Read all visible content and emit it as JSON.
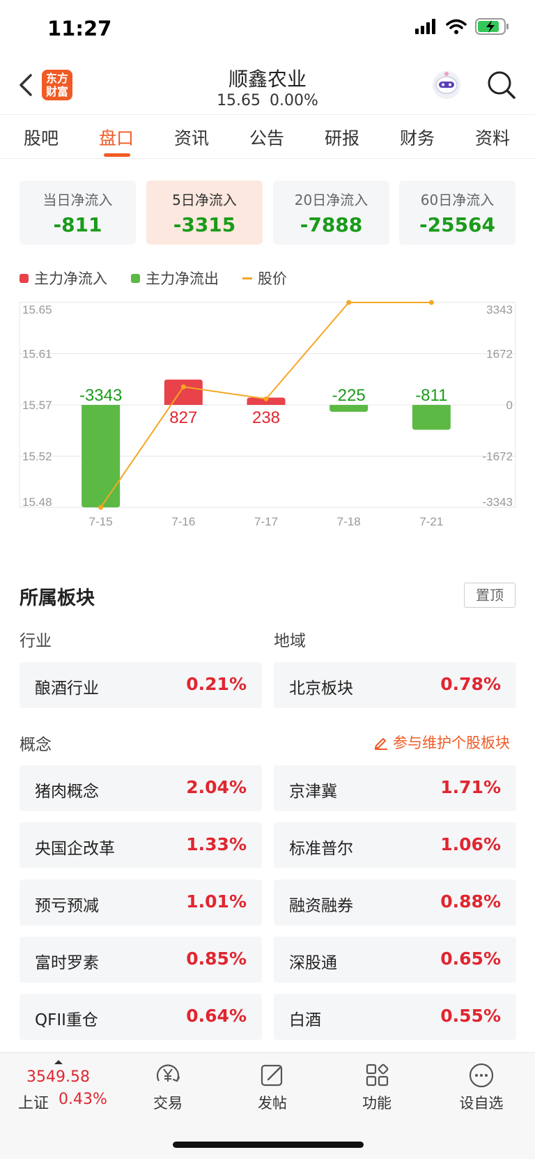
{
  "status": {
    "time": "11:27"
  },
  "header": {
    "stock_name": "顺鑫农业",
    "price": "15.65",
    "change": "0.00%"
  },
  "logo_text": [
    "东方",
    "财富"
  ],
  "tabs": [
    {
      "label": "股吧"
    },
    {
      "label": "盘口"
    },
    {
      "label": "资讯"
    },
    {
      "label": "公告"
    },
    {
      "label": "研报"
    },
    {
      "label": "财务"
    },
    {
      "label": "资料"
    }
  ],
  "active_tab": "盘口",
  "flow_cards": [
    {
      "label": "当日净流入",
      "value": "-811"
    },
    {
      "label": "5日净流入",
      "value": "-3315"
    },
    {
      "label": "20日净流入",
      "value": "-7888"
    },
    {
      "label": "60日净流入",
      "value": "-25564"
    }
  ],
  "legend": {
    "inflow": "主力净流入",
    "outflow": "主力净流出",
    "price": "股价"
  },
  "colors": {
    "accent": "#f05a24",
    "up": "#e0262f",
    "down_bar": "#5cb944",
    "down_text": "#1a9b1a",
    "price_line": "#f5a623",
    "inflow_bar": "#e8424a"
  },
  "chart_data": {
    "type": "bar",
    "categories": [
      "7-15",
      "7-16",
      "7-17",
      "7-18",
      "7-21"
    ],
    "series": [
      {
        "name": "主力净流入/净流出",
        "values": [
          -3343,
          827,
          238,
          -225,
          -811
        ]
      },
      {
        "name": "股价",
        "values": [
          15.48,
          15.58,
          15.57,
          15.65,
          15.65
        ]
      }
    ],
    "value_labels": [
      "-3343",
      "827",
      "238",
      "-225",
      "-811"
    ],
    "left_ticks": [
      "15.65",
      "15.61",
      "15.57",
      "15.52",
      "15.48"
    ],
    "right_ticks": [
      "3343",
      "1672",
      "0",
      "-1672",
      "-3343"
    ],
    "left_range": [
      15.48,
      15.65
    ],
    "right_range": [
      -3343,
      3343
    ],
    "grid": true
  },
  "section": {
    "title": "所属板块",
    "pin_label": "置顶",
    "industry_label": "行业",
    "region_label": "地域",
    "concept_label": "概念",
    "maintain_link": "参与维护个股板块",
    "industry": {
      "name": "酿酒行业",
      "pct": "0.21%"
    },
    "region": {
      "name": "北京板块",
      "pct": "0.78%"
    },
    "concepts": [
      {
        "name": "猪肉概念",
        "pct": "2.04%"
      },
      {
        "name": "京津冀",
        "pct": "1.71%"
      },
      {
        "name": "央国企改革",
        "pct": "1.33%"
      },
      {
        "name": "标准普尔",
        "pct": "1.06%"
      },
      {
        "name": "预亏预减",
        "pct": "1.01%"
      },
      {
        "name": "融资融券",
        "pct": "0.88%"
      },
      {
        "name": "富时罗素",
        "pct": "0.85%"
      },
      {
        "name": "深股通",
        "pct": "0.65%"
      },
      {
        "name": "QFII重仓",
        "pct": "0.64%"
      },
      {
        "name": "白酒",
        "pct": "0.55%"
      }
    ]
  },
  "bottom_nav": {
    "index_value": "3549.58",
    "index_name": "上证",
    "index_change": "0.43%",
    "items": [
      {
        "label": "交易",
        "icon": "yuan-cycle-icon"
      },
      {
        "label": "发帖",
        "icon": "edit-icon"
      },
      {
        "label": "功能",
        "icon": "grid-icon"
      },
      {
        "label": "设自选",
        "icon": "more-icon"
      }
    ]
  }
}
